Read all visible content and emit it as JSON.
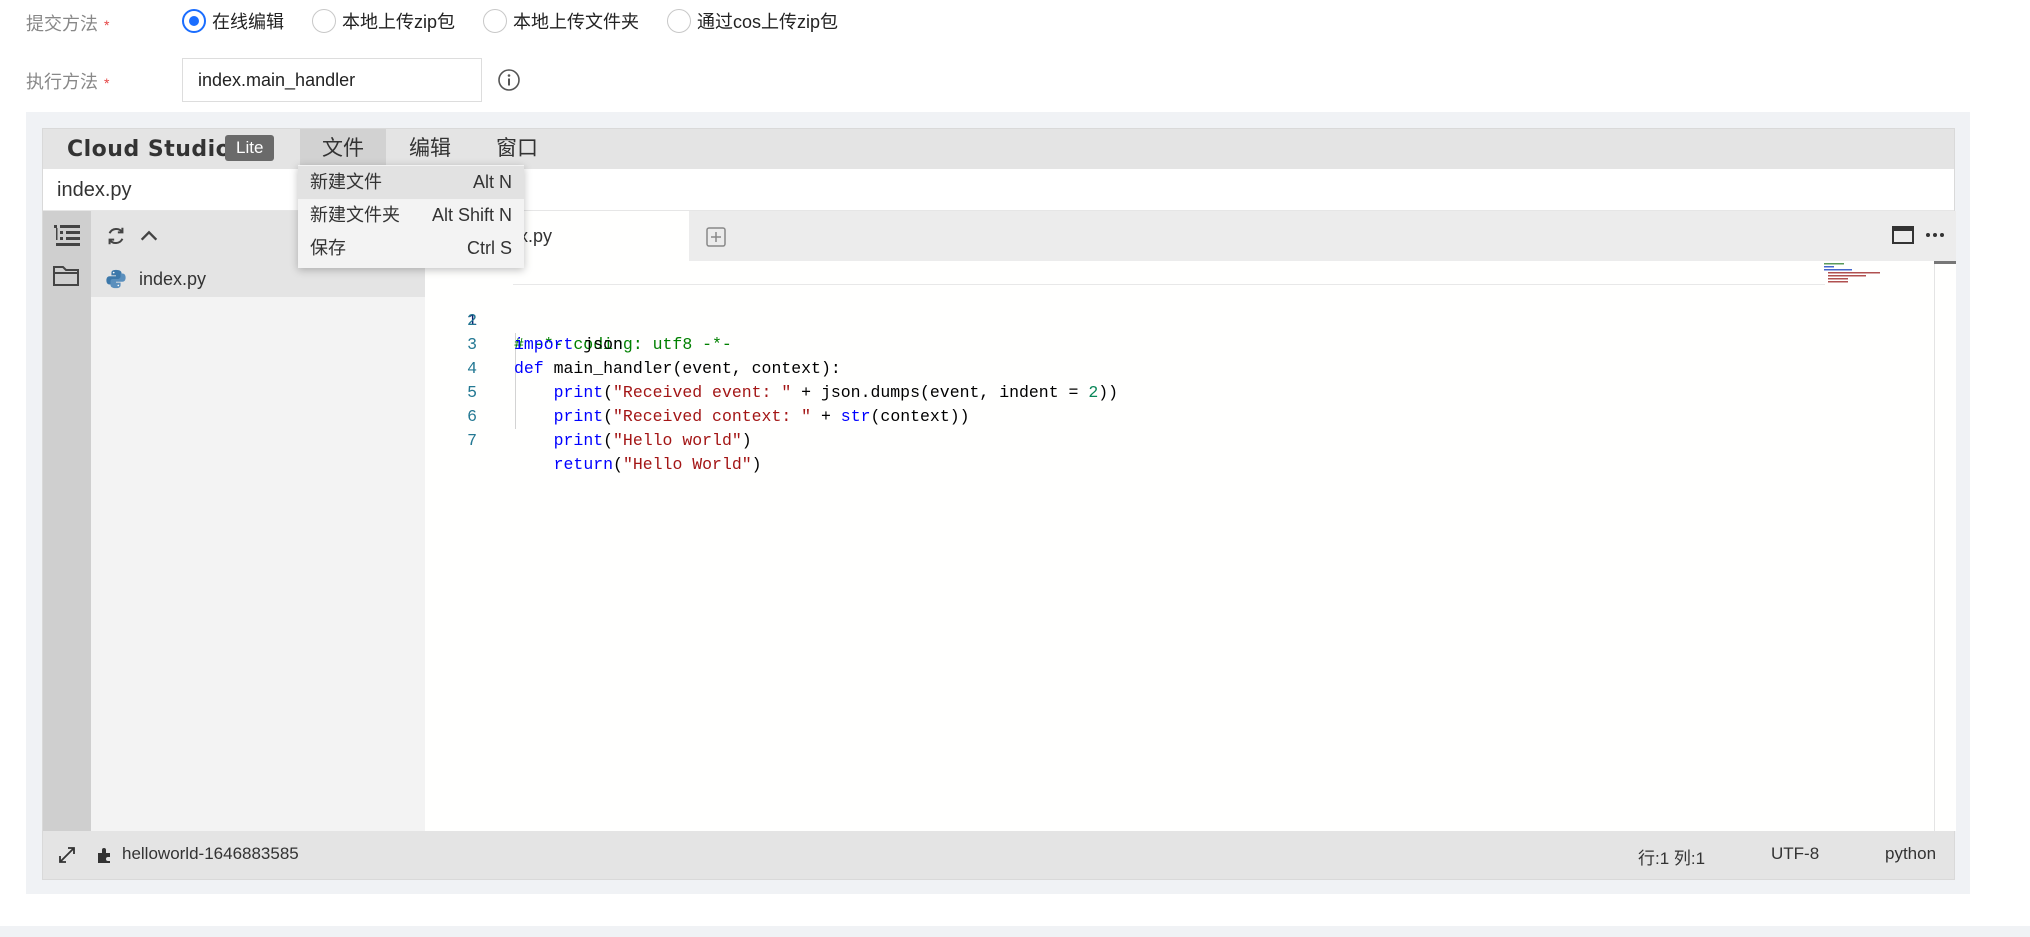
{
  "form": {
    "submit_method_label": "提交方法",
    "required_mark": "*",
    "submit_options": [
      "在线编辑",
      "本地上传zip包",
      "本地上传文件夹",
      "通过cos上传zip包"
    ],
    "selected_option_index": 0,
    "exec_method_label": "执行方法",
    "exec_method_value": "index.main_handler",
    "info_icon": "info-circle-icon"
  },
  "ide": {
    "brand": "Cloud Studio",
    "badge": "Lite",
    "menus": [
      "文件",
      "编辑",
      "窗口"
    ],
    "active_menu": "文件",
    "path": "index.py",
    "file_menu": [
      {
        "label": "新建文件",
        "shortcut": "Alt N"
      },
      {
        "label": "新建文件夹",
        "shortcut": "Alt Shift N"
      },
      {
        "label": "保存",
        "shortcut": "Ctrl S"
      }
    ],
    "sidebar": {
      "files": [
        {
          "name": "index.py",
          "icon": "python-icon"
        }
      ]
    },
    "tab": {
      "label": "index.py",
      "visible_label": "x.py"
    },
    "code_lines": [
      "# -*- coding: utf8 -*-",
      "import json",
      "def main_handler(event, context):",
      "    print(\"Received event: \" + json.dumps(event, indent = 2))",
      "    print(\"Received context: \" + str(context))",
      "    print(\"Hello world\")",
      "    return(\"Hello World\")"
    ],
    "status": {
      "project": "helloworld-1646883585",
      "position": "行:1 列:1",
      "encoding": "UTF-8",
      "language": "python"
    },
    "colors": {
      "accent": "#1a6dff",
      "keyword": "#0000ff",
      "string": "#a31515",
      "comment": "#008000",
      "line_number": "#237893"
    }
  }
}
